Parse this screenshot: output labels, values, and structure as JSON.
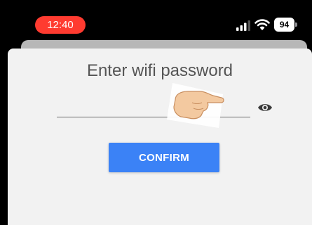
{
  "status_bar": {
    "time": "12:40",
    "battery_level": "94",
    "signal_icon": "cellular-signal-icon",
    "wifi_icon": "wifi-icon",
    "time_pill_color": "#ff3b30"
  },
  "dialog": {
    "title": "Enter wifi password",
    "password_value": "",
    "password_placeholder": "",
    "visibility_icon": "eye-icon",
    "confirm_label": "CONFIRM",
    "confirm_color": "#3b82f6"
  },
  "overlay": {
    "icon": "pointing-hand-icon"
  }
}
